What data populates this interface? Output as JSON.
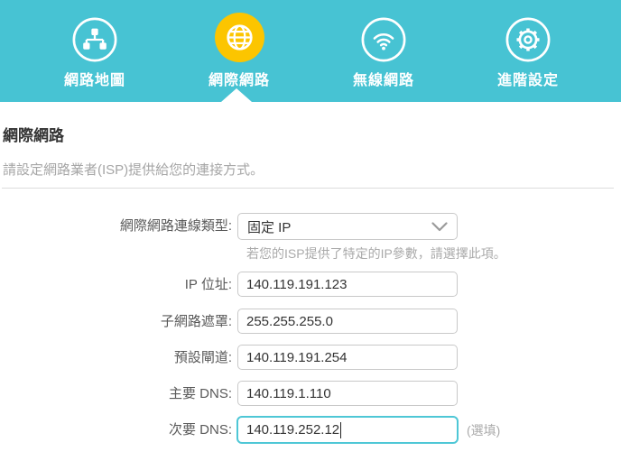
{
  "nav": {
    "tabs": [
      {
        "label": "網路地圖",
        "icon": "sitemap-icon",
        "active": false
      },
      {
        "label": "網際網路",
        "icon": "globe-icon",
        "active": true
      },
      {
        "label": "無線網路",
        "icon": "wifi-icon",
        "active": false
      },
      {
        "label": "進階設定",
        "icon": "gear-icon",
        "active": false
      }
    ]
  },
  "page": {
    "title": "網際網路",
    "description": "請設定網路業者(ISP)提供給您的連接方式。"
  },
  "form": {
    "connection_type": {
      "label": "網際網路連線類型:",
      "value": "固定 IP",
      "helper": "若您的ISP提供了特定的IP參數，請選擇此項。"
    },
    "fields": [
      {
        "label": "IP 位址:",
        "value": "140.119.191.123"
      },
      {
        "label": "子網路遮罩:",
        "value": "255.255.255.0"
      },
      {
        "label": "預設閘道:",
        "value": "140.119.191.254"
      },
      {
        "label": "主要 DNS:",
        "value": "140.119.1.110"
      },
      {
        "label": "次要 DNS:",
        "value": "140.119.252.12",
        "suffix": "(選填)",
        "focused": true
      }
    ]
  },
  "colors": {
    "header_bg": "#47c3d3",
    "active_tab_circle": "#fcc500",
    "icon": "#ffffff",
    "focus_border": "#4ec7d6",
    "input_border": "#c9c9c9",
    "title_text": "#333333",
    "muted_text": "#a6a6a6",
    "label_text": "#595959",
    "divider": "#dcdcdc"
  }
}
